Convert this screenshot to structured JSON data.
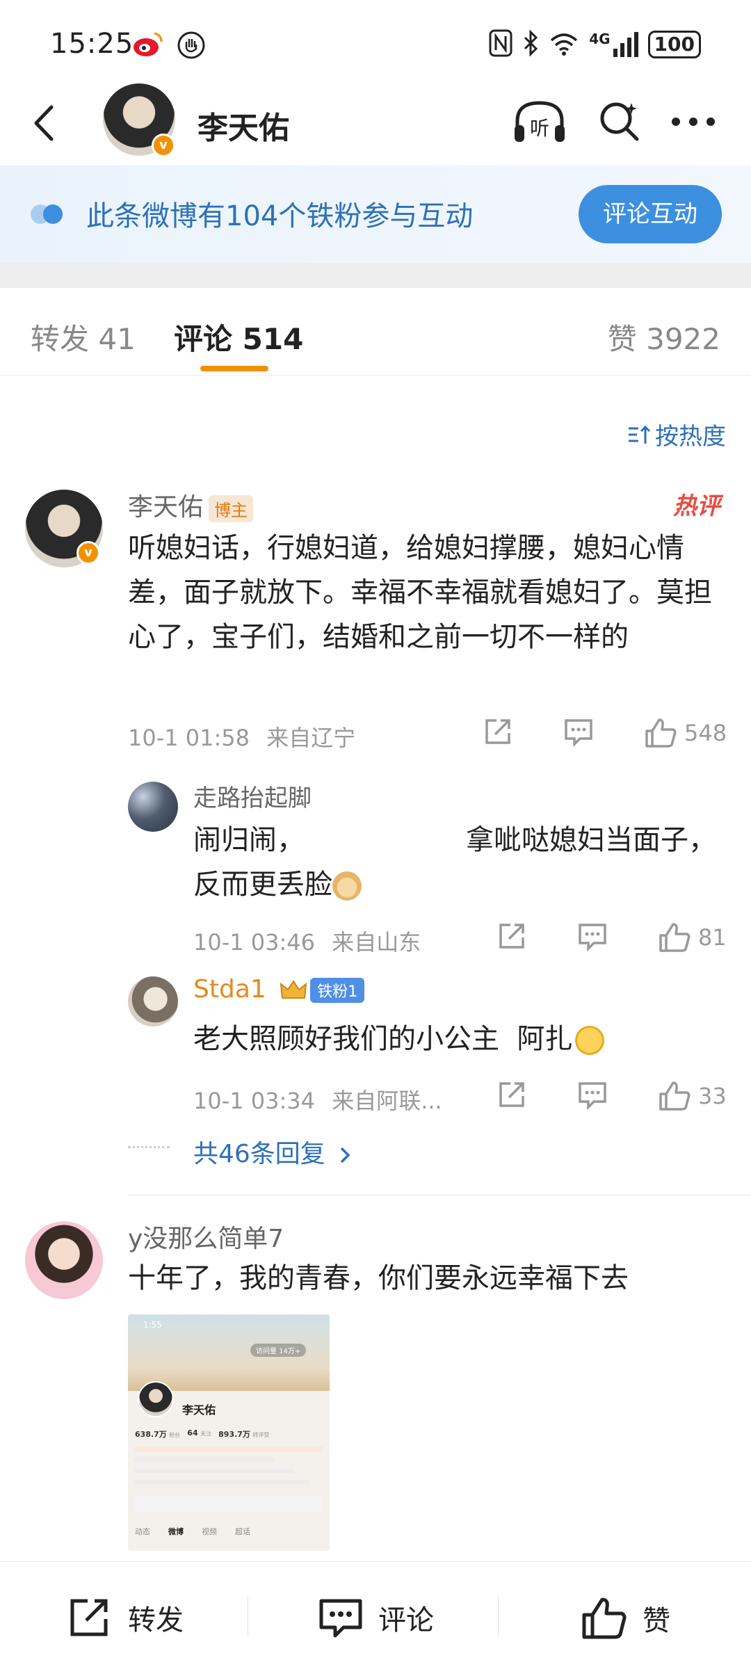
{
  "status": {
    "time": "15:25",
    "network": "4G",
    "battery": "100"
  },
  "header": {
    "author_name": "李天佑"
  },
  "fan_banner": {
    "text": "此条微博有104个铁粉参与互动",
    "button": "评论互动"
  },
  "tabs": {
    "repost": "转发 41",
    "comment": "评论 514",
    "like": "赞 3922"
  },
  "sort": {
    "label": "按热度"
  },
  "comments": [
    {
      "name": "李天佑",
      "tag": "博主",
      "hot_label": "热评",
      "body": "听媳妇话，行媳妇道，给媳妇撑腰，媳妇心情差，面子就放下。幸福不幸福就看媳妇了。莫担心了，宝子们，结婚和之前一切不一样的",
      "time": "10-1 01:58",
      "location": "来自辽宁",
      "likes": "548"
    },
    {
      "name": "y没那么简单7",
      "body": "十年了，我的青春，你们要永远幸福下去"
    }
  ],
  "replies": [
    {
      "name": "走路抬起脚",
      "body_line1_left": "闹归闹，",
      "body_line1_right": "拿呲哒媳妇当面子，",
      "body_line2": "反而更丢脸",
      "time": "10-1 03:46",
      "location": "来自山东",
      "likes": "81"
    },
    {
      "name": "Stda1",
      "fan_badge": "铁粉1",
      "body": "老大照顾好我们的小公主  阿扎",
      "time": "10-1 03:34",
      "location": "来自阿联...",
      "likes": "33"
    }
  ],
  "more_replies": "共46条回复",
  "thumbnail": {
    "time": "1:55",
    "search": "访问量 14万+",
    "name": "李天佑",
    "stats": [
      "638.7万",
      "64",
      "893.7万"
    ],
    "stat_labels": [
      "粉丝",
      "关注",
      "转评赞"
    ],
    "tabs": [
      "动态",
      "微博",
      "视频",
      "超话"
    ]
  },
  "bottom_bar": {
    "repost": "转发",
    "comment": "评论",
    "like": "赞"
  },
  "colors": {
    "accent_blue": "#2d71b8",
    "button_blue": "#3d8fe0",
    "tab_underline": "#f29100",
    "verified": "#f29100",
    "hot": "#ea4b42",
    "fan_name": "#e58a1c"
  }
}
